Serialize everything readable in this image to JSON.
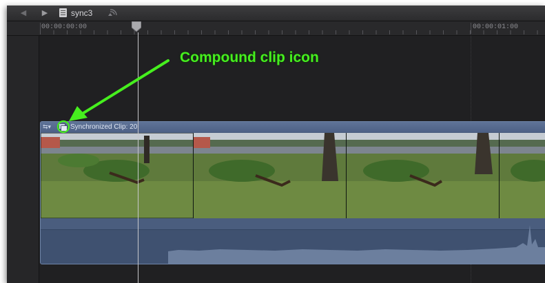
{
  "toolbar": {
    "back_icon": "back-arrow-icon",
    "forward_icon": "forward-arrow-icon",
    "project_icon": "project-document-icon",
    "project_name": "sync3",
    "sync_icon": "broadcast-icon"
  },
  "ruler": {
    "timecode_start": "00:00:00:00",
    "timecode_one_second": "00:00:01:00"
  },
  "clip": {
    "label": "Synchronized Clip: 20",
    "menu_icon": "clip-menu-icon",
    "compound_icon": "compound-clip-icon",
    "color": "#4a5d7e"
  },
  "annotation": {
    "text": "Compound clip icon",
    "color": "#46ef1e"
  }
}
